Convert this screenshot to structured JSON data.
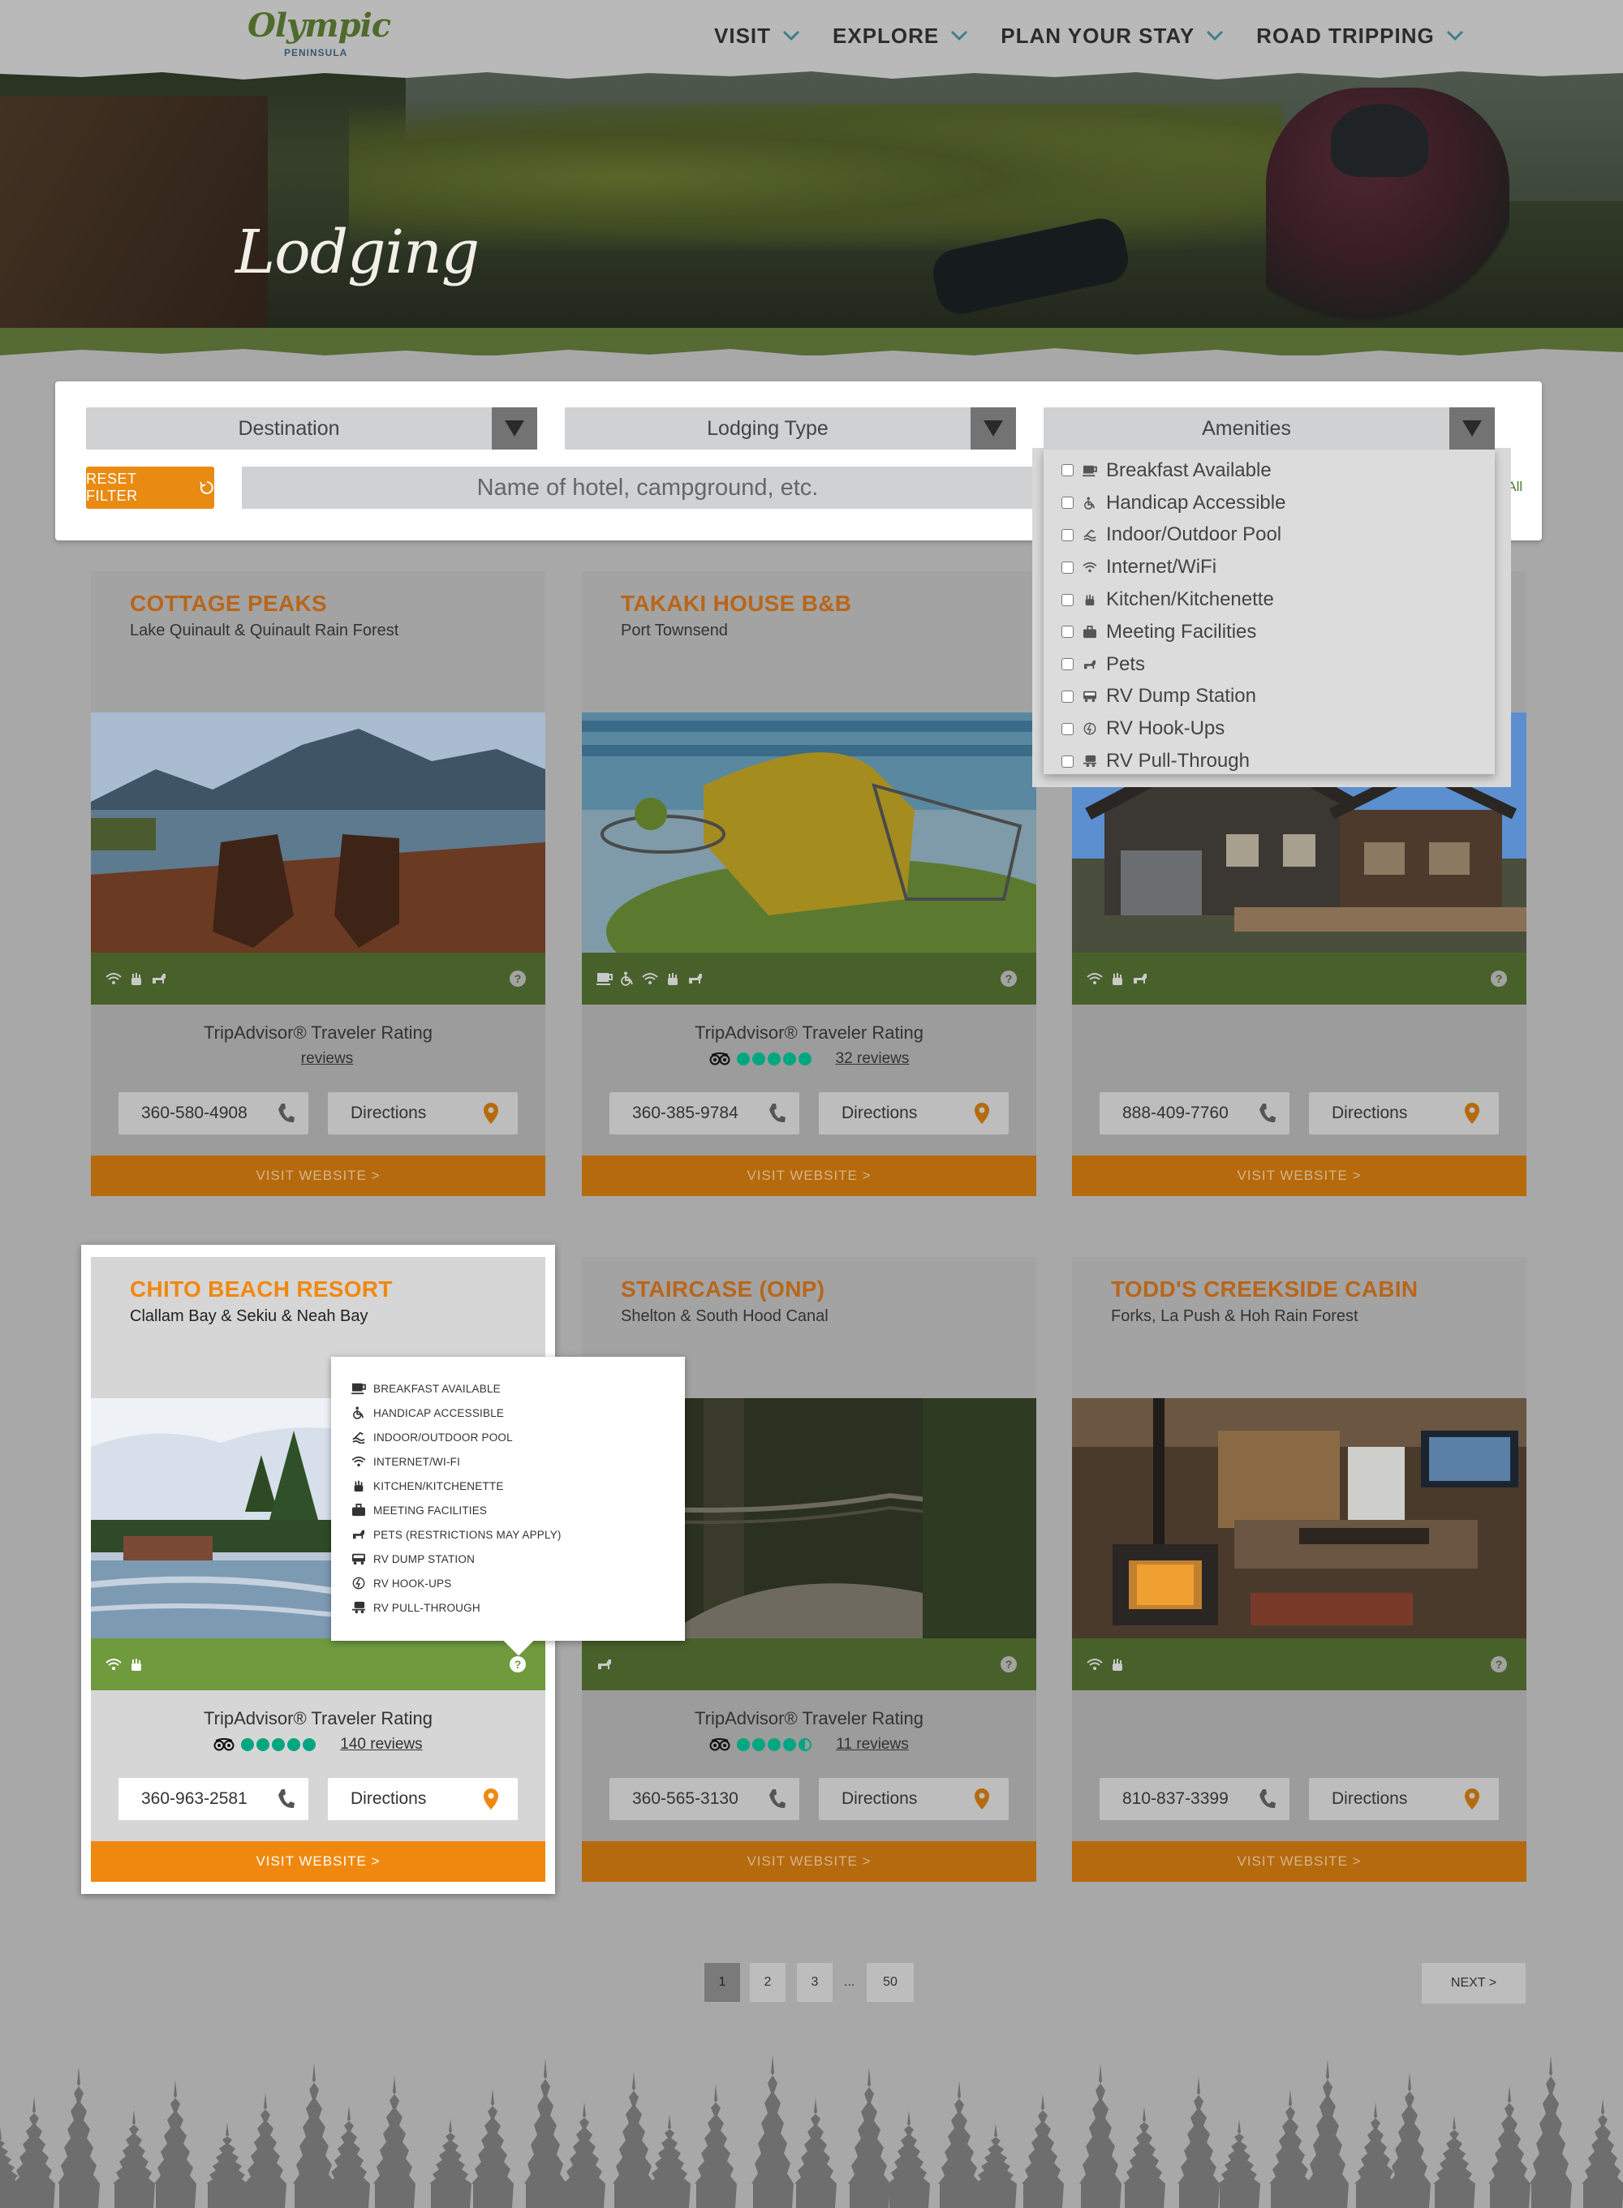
{
  "logo": {
    "main": "Olympic",
    "sub": "PENINSULA"
  },
  "nav": [
    {
      "label": "VISIT"
    },
    {
      "label": "EXPLORE"
    },
    {
      "label": "PLAN YOUR STAY"
    },
    {
      "label": "ROAD TRIPPING"
    }
  ],
  "hero": {
    "title": "Lodging"
  },
  "filters": {
    "destination": "Destination",
    "lodging_type": "Lodging Type",
    "amenities": "Amenities",
    "reset": "RESET FILTER",
    "search_placeholder": "Name of hotel, campground, etc.",
    "all_link": "Z | All"
  },
  "amenities_dropdown": [
    {
      "label": "Breakfast Available",
      "icon": "coffee-icon"
    },
    {
      "label": "Handicap Accessible",
      "icon": "wheelchair-icon"
    },
    {
      "label": "Indoor/Outdoor Pool",
      "icon": "pool-icon"
    },
    {
      "label": "Internet/WiFi",
      "icon": "wifi-icon"
    },
    {
      "label": "Kitchen/Kitchenette",
      "icon": "kitchen-icon"
    },
    {
      "label": "Meeting Facilities",
      "icon": "briefcase-icon"
    },
    {
      "label": "Pets",
      "icon": "dog-icon"
    },
    {
      "label": "RV Dump Station",
      "icon": "rv-icon"
    },
    {
      "label": "RV Hook-Ups",
      "icon": "plug-icon"
    },
    {
      "label": "RV Pull-Through",
      "icon": "rv-pull-icon"
    }
  ],
  "cards": [
    {
      "title": "COTTAGE PEAKS",
      "location": "Lake Quinault & Quinault Rain Forest",
      "rating_label": "TripAdvisor® Traveler Rating",
      "reviews": "reviews",
      "phone": "360-580-4908",
      "directions": "Directions",
      "visit": "VISIT WEBSITE >"
    },
    {
      "title": "TAKAKI HOUSE B&B",
      "location": "Port Townsend",
      "rating_label": "TripAdvisor® Traveler Rating",
      "reviews": "32 reviews",
      "phone": "360-385-9784",
      "directions": "Directions",
      "visit": "VISIT WEBSITE >"
    },
    {
      "title": "",
      "location": "",
      "rating_label": "",
      "reviews": "",
      "phone": "888-409-7760",
      "directions": "Directions",
      "visit": "VISIT WEBSITE >"
    },
    {
      "title": "CHITO BEACH RESORT",
      "location": "Clallam Bay & Sekiu & Neah Bay",
      "rating_label": "TripAdvisor® Traveler Rating",
      "reviews": "140 reviews",
      "phone": "360-963-2581",
      "directions": "Directions",
      "visit": "VISIT WEBSITE >"
    },
    {
      "title": "STAIRCASE (ONP)",
      "location": "Shelton & South Hood Canal",
      "rating_label": "TripAdvisor® Traveler Rating",
      "reviews": "11 reviews",
      "phone": "360-565-3130",
      "directions": "Directions",
      "visit": "VISIT WEBSITE >"
    },
    {
      "title": "TODD'S CREEKSIDE CABIN",
      "location": "Forks, La Push & Hoh Rain Forest",
      "rating_label": "",
      "reviews": "",
      "phone": "810-837-3399",
      "directions": "Directions",
      "visit": "VISIT WEBSITE >"
    }
  ],
  "ratings": {
    "takaki": 5,
    "chito": 5,
    "staircase": 4.5
  },
  "tooltip": [
    {
      "label": "BREAKFAST AVAILABLE",
      "icon": "coffee-icon"
    },
    {
      "label": "HANDICAP ACCESSIBLE",
      "icon": "wheelchair-icon"
    },
    {
      "label": "INDOOR/OUTDOOR POOL",
      "icon": "pool-icon"
    },
    {
      "label": "INTERNET/WI-FI",
      "icon": "wifi-icon"
    },
    {
      "label": "KITCHEN/KITCHENETTE",
      "icon": "kitchen-icon"
    },
    {
      "label": "MEETING FACILITIES",
      "icon": "briefcase-icon"
    },
    {
      "label": "PETS (RESTRICTIONS MAY APPLY)",
      "icon": "dog-icon"
    },
    {
      "label": "RV DUMP STATION",
      "icon": "rv-icon"
    },
    {
      "label": "RV HOOK-UPS",
      "icon": "plug-icon"
    },
    {
      "label": "RV PULL-THROUGH",
      "icon": "rv-pull-icon"
    }
  ],
  "pagination": {
    "pages": [
      "1",
      "2",
      "3"
    ],
    "ellipsis": "...",
    "last": "50",
    "next": "NEXT >"
  },
  "colors": {
    "accent_orange": "#f0880f",
    "green": "#6f9a3e",
    "title_orange": "#b8661a"
  }
}
